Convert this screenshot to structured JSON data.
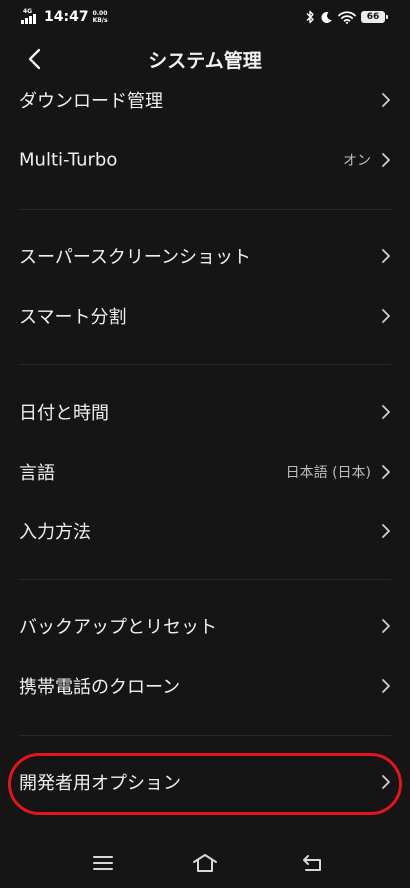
{
  "status_bar": {
    "network": "4G",
    "time": "14:47",
    "speed_value": "0.00",
    "speed_unit": "KB/s",
    "battery": "66"
  },
  "header": {
    "title": "システム管理"
  },
  "rows": [
    {
      "label": "ダウンロード管理",
      "value": ""
    },
    {
      "label": "Multi-Turbo",
      "value": "オン"
    },
    {
      "label": "スーパースクリーンショット",
      "value": ""
    },
    {
      "label": "スマート分割",
      "value": ""
    },
    {
      "label": "日付と時間",
      "value": ""
    },
    {
      "label": "言語",
      "value": "日本語 (日本)"
    },
    {
      "label": "入力方法",
      "value": ""
    },
    {
      "label": "バックアップとリセット",
      "value": ""
    },
    {
      "label": "携帯電話のクローン",
      "value": ""
    },
    {
      "label": "開発者用オプション",
      "value": ""
    }
  ],
  "colors": {
    "background": "#151515",
    "text": "#f0f0f0",
    "highlight_circle": "#e4141b"
  },
  "icons": {
    "back": "chevron-left-icon",
    "row_arrow": "chevron-right-icon",
    "nav_menu": "menu-icon",
    "nav_home": "home-icon",
    "nav_back": "return-icon"
  }
}
